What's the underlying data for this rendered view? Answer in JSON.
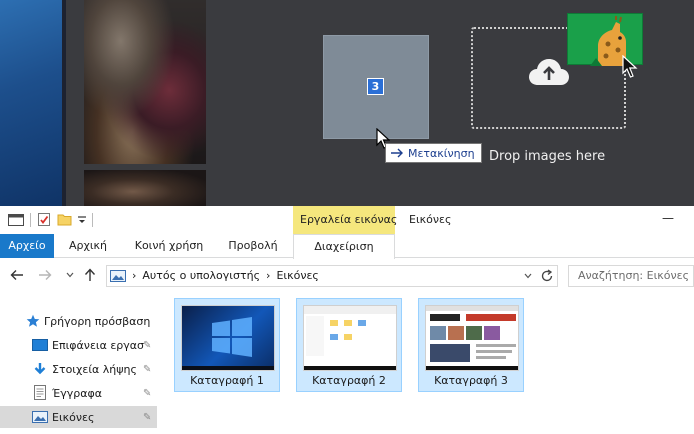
{
  "drag": {
    "count_badge": "3",
    "tooltip_text": "Μετακίνηση",
    "drop_zone_text": "Drop images here"
  },
  "explorer": {
    "contextual_tab_label": "Εργαλεία εικόνας",
    "window_title": "Εικόνες",
    "minimize_glyph": "—",
    "ribbon_tabs": [
      "Αρχείο",
      "Αρχική",
      "Κοινή χρήση",
      "Προβολή",
      "Διαχείριση"
    ],
    "address": {
      "path": [
        "Αυτός ο υπολογιστής",
        "Εικόνες"
      ],
      "separator": "›"
    },
    "search": {
      "placeholder": "Αναζήτηση: Εικόνες"
    },
    "nav": [
      {
        "label": "Γρήγορη πρόσβαση",
        "icon": "star-icon"
      },
      {
        "label": "Επιφάνεια εργασ",
        "icon": "desktop-icon",
        "pinned": true
      },
      {
        "label": "Στοιχεία λήψης",
        "icon": "download-icon",
        "pinned": true
      },
      {
        "label": "Έγγραφα",
        "icon": "document-icon",
        "pinned": true
      },
      {
        "label": "Εικόνες",
        "icon": "pictures-icon",
        "pinned": true,
        "selected": true
      }
    ],
    "files": [
      {
        "name": "Καταγραφή 1"
      },
      {
        "name": "Καταγραφή 2"
      },
      {
        "name": "Καταγραφή 3"
      }
    ]
  },
  "colors": {
    "accent": "#1979ca",
    "selection": "#cce8ff",
    "contextual_tab": "#f5e77d",
    "dark_panel": "#3a3b3f",
    "badge": "#2b6fd6",
    "giraffe_tile": "#1aa04a"
  }
}
